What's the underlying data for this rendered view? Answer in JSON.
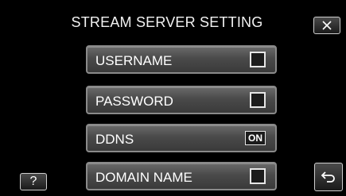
{
  "header": {
    "title": "STREAM SERVER SETTING",
    "close_icon": "close-icon"
  },
  "menu": {
    "items": [
      {
        "label": "USERNAME",
        "control": "checkbox"
      },
      {
        "label": "PASSWORD",
        "control": "checkbox"
      },
      {
        "label": "DDNS",
        "control": "toggle",
        "state": "ON"
      },
      {
        "label": "DOMAIN NAME",
        "control": "checkbox"
      }
    ]
  },
  "footer": {
    "help_label": "?",
    "back_icon": "back-arrow-icon"
  }
}
